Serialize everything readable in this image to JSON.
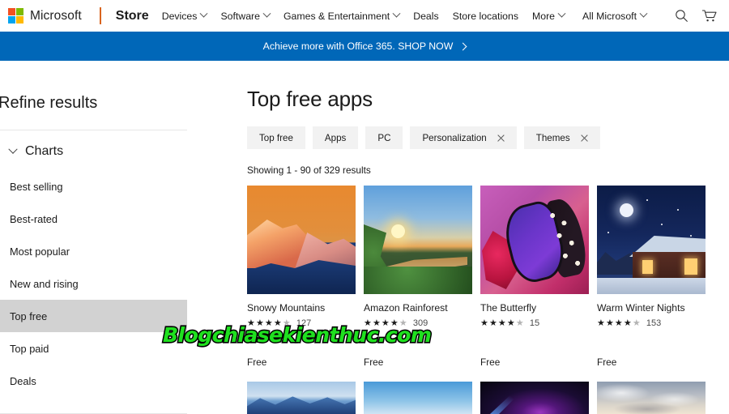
{
  "topnav": {
    "brand": "Microsoft",
    "store_label": "Store",
    "items": [
      {
        "label": "Devices",
        "caret": true
      },
      {
        "label": "Software",
        "caret": true
      },
      {
        "label": "Games & Entertainment",
        "caret": true
      },
      {
        "label": "Deals",
        "caret": false
      },
      {
        "label": "Store locations",
        "caret": false
      },
      {
        "label": "More",
        "caret": true
      }
    ],
    "all_microsoft": "All Microsoft",
    "search_icon": "search-icon",
    "cart_icon": "shopping-cart-icon",
    "logo_colors": [
      "#f25022",
      "#7fba00",
      "#00a4ef",
      "#ffb900"
    ],
    "divider_color": "#d9641e"
  },
  "promo": {
    "text": "Achieve more with Office 365. SHOP NOW",
    "arrow_icon": "chevron-right-icon",
    "background": "#0067b8"
  },
  "sidebar": {
    "title": "Refine results",
    "group_label": "Charts",
    "group_caret_icon": "chevron-down-icon",
    "items": [
      {
        "label": "Best selling",
        "active": false
      },
      {
        "label": "Best-rated",
        "active": false
      },
      {
        "label": "Most popular",
        "active": false
      },
      {
        "label": "New and rising",
        "active": false
      },
      {
        "label": "Top free",
        "active": true
      },
      {
        "label": "Top paid",
        "active": false
      },
      {
        "label": "Deals",
        "active": false
      }
    ],
    "active_background": "#d2d2d2"
  },
  "main": {
    "title": "Top free apps",
    "filters": [
      {
        "label": "Top free",
        "removable": false
      },
      {
        "label": "Apps",
        "removable": false
      },
      {
        "label": "PC",
        "removable": false
      },
      {
        "label": "Personalization",
        "removable": true
      },
      {
        "label": "Themes",
        "removable": true
      }
    ],
    "showing": "Showing 1 - 90 of 329 results",
    "cards": [
      {
        "title": "Snowy Mountains",
        "stars_full": 4,
        "stars_half": 1,
        "reviews": "127",
        "price": "Free",
        "art": "t-mount"
      },
      {
        "title": "Amazon Rainforest",
        "stars_full": 4,
        "stars_half": 1,
        "reviews": "309",
        "price": "Free",
        "art": "t-forest"
      },
      {
        "title": "The Butterfly",
        "stars_full": 4,
        "stars_half": 1,
        "reviews": "15",
        "price": "Free",
        "art": "t-butterfly"
      },
      {
        "title": "Warm Winter Nights",
        "stars_full": 4,
        "stars_half": 1,
        "reviews": "153",
        "price": "Free",
        "art": "t-cabin"
      }
    ],
    "cards_row2": [
      {
        "art": "t-blue-mtn"
      },
      {
        "art": "t-sky"
      },
      {
        "art": "t-nebula"
      },
      {
        "art": "t-clouds"
      }
    ]
  },
  "watermark": {
    "text": "Blogchiasekienthuc.com",
    "color": "#1fe01f",
    "outline": "#000000"
  }
}
